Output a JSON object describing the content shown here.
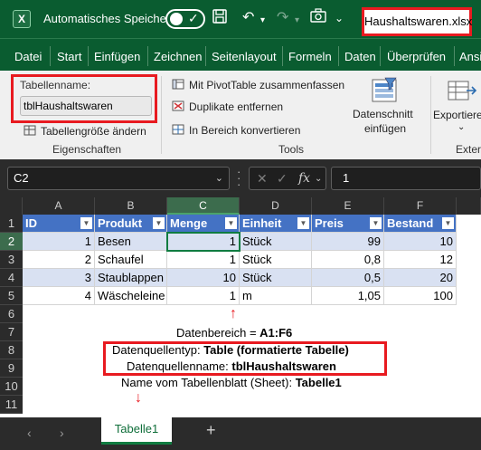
{
  "titlebar": {
    "app_icon": "X",
    "autosave_label": "Automatisches Speichern",
    "filename": "Haushaltswaren.xlsx"
  },
  "menu": [
    "Datei",
    "Start",
    "Einfügen",
    "Zeichnen",
    "Seitenlayout",
    "Formeln",
    "Daten",
    "Überprüfen",
    "Ansi"
  ],
  "ribbon": {
    "table_name_label": "Tabellenname:",
    "table_name_value": "tblHaushaltswaren",
    "resize_label": "Tabellengröße ändern",
    "group_properties": "Eigenschaften",
    "pivot_label": "Mit PivotTable zusammenfassen",
    "dedupe_label": "Duplikate entfernen",
    "convert_label": "In Bereich konvertieren",
    "group_tools": "Tools",
    "slicer_line1": "Datenschnitt",
    "slicer_line2": "einfügen",
    "export_label": "Exportiere",
    "group_external": "Extern"
  },
  "formula": {
    "namebox": "C2",
    "content": "1"
  },
  "columns": [
    "A",
    "B",
    "C",
    "D",
    "E",
    "F"
  ],
  "rows": [
    "1",
    "2",
    "3",
    "4",
    "5",
    "6",
    "7",
    "8",
    "9",
    "10",
    "11"
  ],
  "table": {
    "headers": [
      "ID",
      "Produkt",
      "Menge",
      "Einheit",
      "Preis",
      "Bestand"
    ],
    "data": [
      [
        "1",
        "Besen",
        "1",
        "Stück",
        "99",
        "10"
      ],
      [
        "2",
        "Schaufel",
        "1",
        "Stück",
        "0,8",
        "12"
      ],
      [
        "3",
        "Staublappen",
        "10",
        "Stück",
        "0,5",
        "20"
      ],
      [
        "4",
        "Wäscheleine",
        "1",
        "m",
        "1,05",
        "100"
      ]
    ]
  },
  "annotations": {
    "range_prefix": "Datenbereich = ",
    "range_value": "A1:F6",
    "type_prefix": "Datenquellentyp: ",
    "type_value": "Table (formatierte Tabelle)",
    "name_prefix": "Datenquellenname: ",
    "name_value": "tblHaushaltswaren",
    "sheet_prefix": "Name vom Tabellenblatt (Sheet): ",
    "sheet_value": "Tabelle1"
  },
  "sheet_tab": "Tabelle1",
  "colors": {
    "excel_green": "#0a5c30",
    "table_header": "#4472c4",
    "table_band": "#d9e1f2",
    "highlight_red": "#e81a20"
  }
}
